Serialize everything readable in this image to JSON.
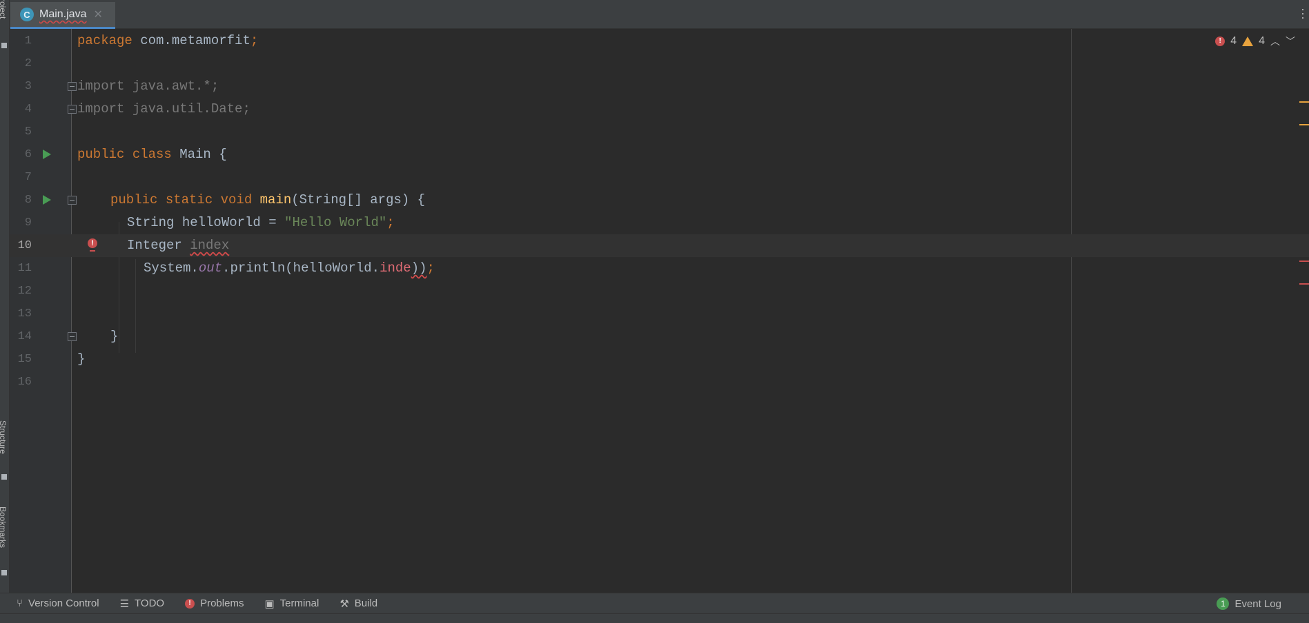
{
  "window": {
    "tab": {
      "label": "Main.java",
      "icon": "java-class-icon",
      "close": "✕"
    }
  },
  "side_tabs": {
    "project": "Project",
    "structure": "Structure",
    "bookmarks": "Bookmarks"
  },
  "editor": {
    "current_line": 10,
    "line_numbers": [
      "1",
      "2",
      "3",
      "4",
      "5",
      "6",
      "7",
      "8",
      "9",
      "10",
      "11",
      "12",
      "13",
      "14",
      "15",
      "16"
    ],
    "lines": {
      "l1_kw": "package",
      "l1_rest": " com.metamorfit",
      "l1_semi": ";",
      "l3": "import java.awt.*;",
      "l4": "import java.util.Date;",
      "l6_kw": "public class",
      "l6_rest": " Main {",
      "l8_kw": "public static void",
      "l8_method": "main",
      "l8_rest": "(String[] args) {",
      "l9_decl": "String helloWorld = ",
      "l9_str": "\"Hello World\"",
      "l9_semi": ";",
      "l10_type": "Integer ",
      "l10_var": "index",
      "l11_pre": "System.",
      "l11_field": "out",
      "l11_mid": ".println(helloWorld.",
      "l11_err": "inde",
      "l11_close": "))",
      "l11_semi": ";",
      "l14": "}",
      "l15": "}"
    },
    "inspection": {
      "errors": "4",
      "warnings": "4"
    }
  },
  "bottom_toolbar": {
    "version_control": "Version Control",
    "todo": "TODO",
    "problems": "Problems",
    "terminal": "Terminal",
    "build": "Build",
    "event_log": "Event Log",
    "event_log_count": "1"
  },
  "colors": {
    "keyword": "#cc7832",
    "string": "#6a8759",
    "method": "#ffc66d",
    "error": "#c94f4f",
    "warning": "#e8a33e",
    "run": "#499c54"
  }
}
